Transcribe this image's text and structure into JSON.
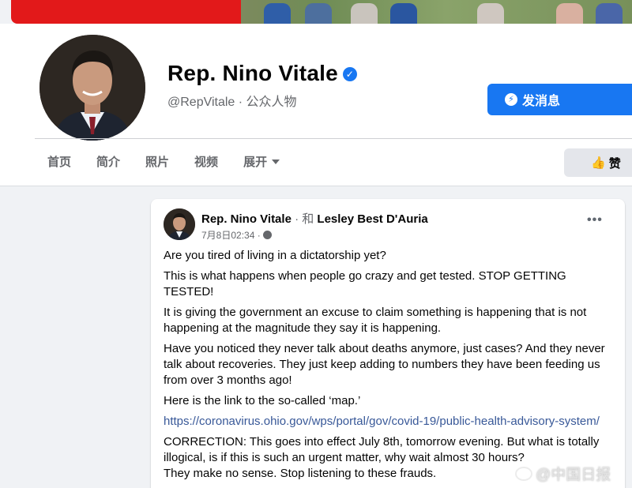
{
  "header": {
    "page_name": "Rep. Nino Vitale",
    "handle_category": "@RepVitale · 公众人物",
    "message_button": "发消息",
    "like_button": "赞",
    "tabs": [
      "首页",
      "简介",
      "照片",
      "视频",
      "展开"
    ]
  },
  "post": {
    "author": "Rep. Nino Vitale",
    "with_separator": " · 和 ",
    "tagged": "Lesley Best D'Auria",
    "timestamp": "7月8日02:34 ·",
    "paragraphs": [
      "Are you tired of living in a dictatorship yet?",
      "This is what happens when people go crazy and get tested. STOP GETTING TESTED!",
      "It is giving the government an excuse to claim something is happening that is not happening at the magnitude they say it is happening.",
      "Have you noticed they never talk about deaths anymore, just cases? And they never talk about recoveries.  They just keep adding to numbers they have been feeding us from over 3 months ago!",
      "Here is the link to the so-called ‘map.’"
    ],
    "link": "https://coronavirus.ohio.gov/wps/portal/gov/covid-19/public-health-advisory-system/",
    "correction": "CORRECTION: This goes into effect July 8th, tomorrow evening. But what is totally illogical, is if this is such an urgent matter, why wait almost 30 hours?",
    "closing": "They make no sense. Stop listening to these frauds."
  },
  "watermark": "@中国日报",
  "colors": {
    "accent": "#1877f2",
    "link": "#385898",
    "cover_red": "#e2191a"
  }
}
